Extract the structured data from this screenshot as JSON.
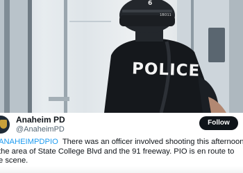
{
  "photo": {
    "vest_text": "POLICE",
    "helmet_number": "6",
    "helmet_code": "1BO11"
  },
  "tweet": {
    "display_name": "Anaheim PD",
    "handle": "@AnaheimPD",
    "follow_label": "Follow",
    "hashtag": "ANAHEIMPDPIO",
    "body_line1": "There was an officer involved shooting this afternoon",
    "body_line2": "the area of State College Blvd and the 91 freeway. PIO is en route to",
    "body_line3": "e scene."
  },
  "colors": {
    "link": "#1d9bf0",
    "text": "#0f1419",
    "muted": "#536471",
    "button": "#0f1419"
  }
}
